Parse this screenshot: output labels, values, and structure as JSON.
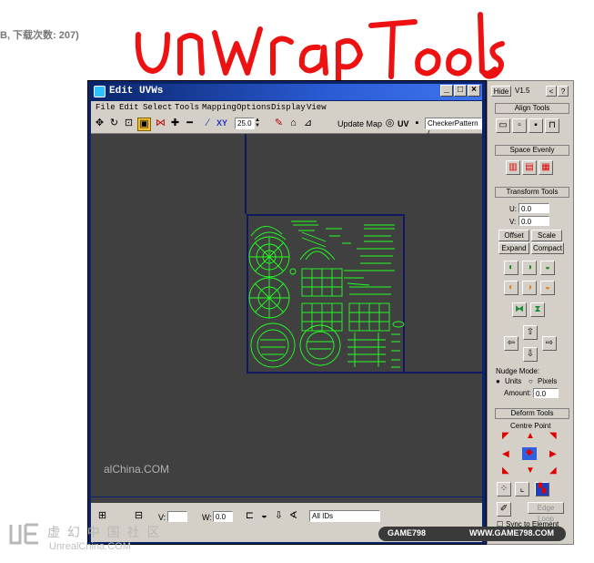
{
  "caption": "B, 下载次数: 207)",
  "handwritten_title": "unwrap Tools",
  "window": {
    "title": "Edit UVWs",
    "buttons": [
      "_",
      "□",
      "×"
    ],
    "menu": [
      "File",
      "Edit",
      "Select",
      "Tools",
      "Mapping",
      "Options",
      "Display",
      "View"
    ],
    "toolbar": {
      "axis_label": "XY",
      "zoom_value": "25.0",
      "update_map_label": "Update Map",
      "uv_label": "UV",
      "texture_select": "CheckerPattern ("
    },
    "bottom": {
      "v_label": "V:",
      "w_label": "W:",
      "w_value": "0.0",
      "filter_select": "All IDs"
    }
  },
  "rollout": {
    "hide_label": "Hide",
    "version": "V1.5",
    "nav_buttons": [
      "<",
      "?"
    ],
    "align_tools": "Align Tools",
    "space_evenly": "Space Evenly",
    "transform_tools": "Transform Tools",
    "u_label": "U:",
    "u_value": "0.0",
    "v_label": "V:",
    "v_value": "0.0",
    "offset_label": "Offset",
    "scale_label": "Scale",
    "expand_label": "Expand",
    "compact_label": "Compact",
    "nudge_mode": "Nudge Mode:",
    "units_label": "Units",
    "pixels_label": "Pixels",
    "amount_label": "Amount:",
    "amount_value": "0.0",
    "deform_tools": "Deform Tools",
    "centre_point": "Centre Point",
    "edge_loop": "Edge Loop",
    "sync_label": "Sync to Element"
  },
  "watermarks": {
    "site_small": "alChina.COM",
    "logo_cn": "虚 幻 中 国 社 区",
    "logo_en": "UnrealChina.COM",
    "game_left": "GAME798",
    "game_right": "WWW.GAME798.COM"
  },
  "colors": {
    "title_bar": "#0a246a",
    "uv_lines": "#22ff22",
    "border_blue": "#101860",
    "viewport_bg": "#404040"
  }
}
